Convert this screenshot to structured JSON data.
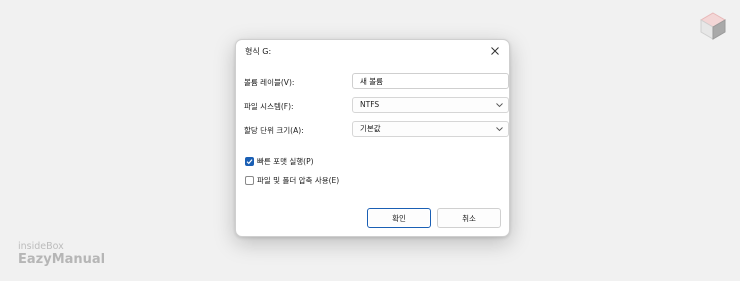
{
  "dialog": {
    "title": "형식 G:",
    "fields": {
      "volume_label": {
        "label": "볼륨 레이블(V):",
        "value": "새 볼륨"
      },
      "file_system": {
        "label": "파일 시스템(F):",
        "value": "NTFS"
      },
      "allocation_unit": {
        "label": "할당 단위 크기(A):",
        "value": "기본값"
      }
    },
    "options": {
      "quick_format": {
        "label": "빠른 포맷 실행(P)",
        "checked": true
      },
      "compression": {
        "label": "파일 및 폴더 압축 사용(E)",
        "checked": false
      }
    },
    "buttons": {
      "ok": "확인",
      "cancel": "취소"
    }
  },
  "watermark": {
    "line1": "insideBox",
    "line2": "EazyManual"
  },
  "colors": {
    "accent": "#1a5fb4",
    "watermark_red": "#f0c8c8",
    "watermark_gray": "#bcbcbc"
  },
  "icons": [
    "close-icon",
    "chevron-down-icon",
    "checkmark-icon",
    "cube-logo-icon"
  ]
}
